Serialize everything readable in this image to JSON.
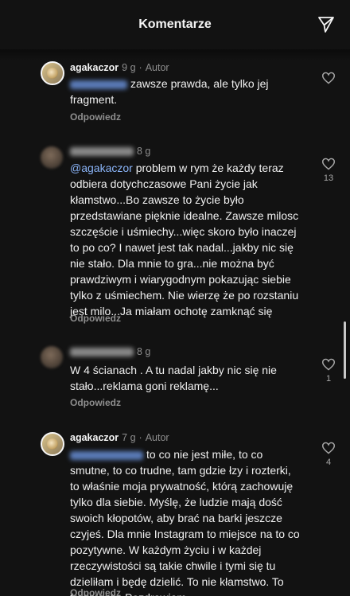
{
  "header": {
    "title": "Komentarze"
  },
  "comments": [
    {
      "user": "agakaczor",
      "time": "9 g",
      "tag": "Autor",
      "text": "zawsze prawda, ale tylko jej fragment.",
      "reply": "Odpowiedz",
      "likes": ""
    },
    {
      "user": "",
      "time": "8 g",
      "tag": "",
      "mention": "@agakaczor",
      "text": "problem w rym że każdy teraz odbiera dotychczasowe Pani życie jak kłamstwo...Bo zawsze to życie było przedstawiane pięknie idealne. Zawsze milosc szczęście i uśmiechy...więc skoro było inaczej to po co? I nawet jest tak nadal...jakby nic się nie stało. Dla mnie to gra...nie można być prawdziwym i wiarygodnym pokazując siebie tylko z uśmiechem. Nie wierzę że po rozstaniu jest milo...Ja miałam ochotę zamknąć się",
      "reply": "Odpowiedz",
      "likes": "13"
    },
    {
      "user": "",
      "time": "8 g",
      "tag": "",
      "text": "W 4 ścianach . A tu nadal jakby nic się nie stało...reklama goni reklamę...",
      "reply": "Odpowiedz",
      "likes": "1"
    },
    {
      "user": "agakaczor",
      "time": "7 g",
      "tag": "Autor",
      "text": "to co nie jest miłe, to co smutne, to co trudne, tam gdzie łzy i rozterki, to właśnie moja prywatność, którą zachowuję tylko dla siebie. Myślę, że ludzie mają dość swoich kłopotów, aby brać na barki jeszcze czyjeś. Dla mnie Instagram to miejsce na to co pozytywne. W każdym życiu i w każdej rzeczywistości są takie chwile i tymi się tu dzieliłam i będę dzielić. To nie kłamstwo. To fragmenty. Pozdrawiam.",
      "reply": "Odpowiedz",
      "likes": "4"
    }
  ]
}
